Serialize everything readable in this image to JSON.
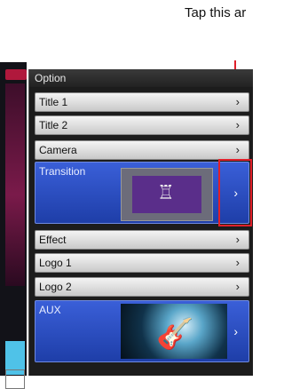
{
  "annotation": {
    "text": "Tap this ar"
  },
  "panel": {
    "title": "Option",
    "items": [
      {
        "label": "Title 1",
        "chevron": "›"
      },
      {
        "label": "Title 2",
        "chevron": "›"
      },
      {
        "label": "Camera",
        "chevron": "›"
      },
      {
        "label": "Transition",
        "chevron": "›"
      },
      {
        "label": "Effect",
        "chevron": "›"
      },
      {
        "label": "Logo 1",
        "chevron": "›"
      },
      {
        "label": "Logo 2",
        "chevron": "›"
      },
      {
        "label": "AUX",
        "chevron": "›"
      }
    ]
  },
  "colors": {
    "callout": "#e0202a",
    "selected": "#2b4fc8"
  },
  "icons": {
    "transition_thumb": "transition-glyph-icon",
    "aux_thumb": "guitarist-photo"
  }
}
